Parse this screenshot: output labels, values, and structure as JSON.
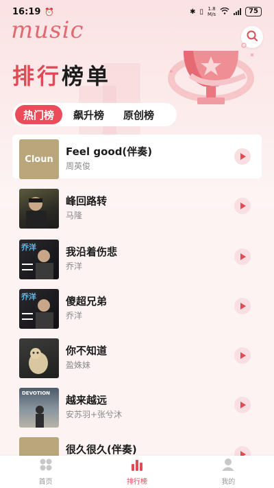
{
  "status_bar": {
    "time": "16:19",
    "net_speed_top": "1.8",
    "net_speed_bottom": "M/s",
    "battery": "75"
  },
  "app": {
    "logo_text": "music"
  },
  "page": {
    "title_part1": "排行",
    "title_part2": "榜单"
  },
  "tabs": [
    {
      "label": "热门榜",
      "active": true
    },
    {
      "label": "飙升榜",
      "active": false
    },
    {
      "label": "原创榜",
      "active": false
    }
  ],
  "cover_texts": {
    "song0": "Cloun",
    "song2": "乔洋",
    "song3": "乔洋",
    "song5": "DEVOTION"
  },
  "songs": [
    {
      "title": "Feel good(伴奏)",
      "artist": "周英俊"
    },
    {
      "title": "峰回路转",
      "artist": "马隆"
    },
    {
      "title": "我沿着伤悲",
      "artist": "乔洋"
    },
    {
      "title": "傻超兄弟",
      "artist": "乔洋"
    },
    {
      "title": "你不知道",
      "artist": "盈姝妹"
    },
    {
      "title": "越来越远",
      "artist": "安苏羽+张兮沐"
    },
    {
      "title": "很久很久(伴奏)",
      "artist": ""
    }
  ],
  "bottom_nav": [
    {
      "label": "首页",
      "icon": "grid-icon"
    },
    {
      "label": "排行榜",
      "icon": "chart-bars-icon"
    },
    {
      "label": "我的",
      "icon": "user-icon"
    }
  ],
  "colors": {
    "accent": "#e04a55",
    "tab_active": "#ea4d59",
    "play_bg": "#f9dfe1"
  }
}
